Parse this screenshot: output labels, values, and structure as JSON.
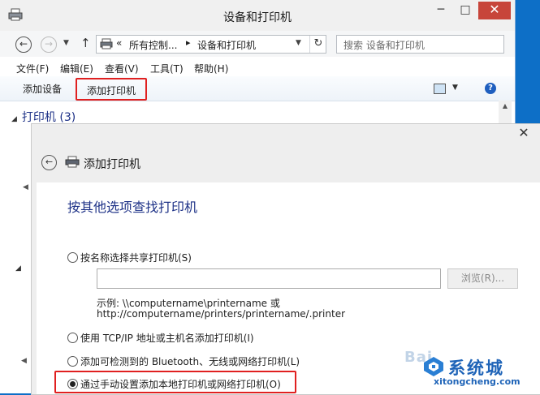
{
  "window": {
    "title": "设备和打印机",
    "controls": {
      "minimize": "─",
      "maximize": "□",
      "close": "✕"
    }
  },
  "address_bar": {
    "overflow": "«",
    "crumbs": [
      "所有控制...",
      "设备和打印机"
    ],
    "separator": "▸",
    "refresh": "↻",
    "back": "←",
    "forward": "→",
    "up": "↑",
    "search_placeholder": "搜索 设备和打印机"
  },
  "menu": {
    "file": "文件(F)",
    "edit": "编辑(E)",
    "view": "查看(V)",
    "tools": "工具(T)",
    "help": "帮助(H)"
  },
  "command_bar": {
    "add_device": "添加设备",
    "add_printer": "添加打印机",
    "help": "?"
  },
  "content": {
    "printers_group": "打印机 (3)"
  },
  "dialog": {
    "close": "✕",
    "back": "←",
    "title": "添加打印机",
    "heading": "按其他选项查找打印机",
    "options": [
      {
        "label": "按名称选择共享打印机(S)",
        "selected": false
      },
      {
        "label": "使用 TCP/IP 地址或主机名添加打印机(I)",
        "selected": false
      },
      {
        "label": "添加可检测到的 Bluetooth、无线或网络打印机(L)",
        "selected": false
      },
      {
        "label": "通过手动设置添加本地打印机或网络打印机(O)",
        "selected": true
      }
    ],
    "share_input_value": "",
    "browse_button": "浏览(R)...",
    "example_line1": "示例: \\\\computername\\printername 或",
    "example_line2": "http://computername/printers/printername/.printer"
  },
  "watermark": {
    "brand": "系统城",
    "url": "xitongcheng.com",
    "faint": "Bai"
  },
  "icons": [
    "app-printer-icon",
    "back-icon",
    "forward-icon",
    "up-icon",
    "refresh-icon",
    "view-options-icon",
    "help-icon",
    "printer-icon",
    "close-icon"
  ],
  "colors": {
    "accent_red": "#e02020",
    "heading_blue": "#1e3287",
    "close_red": "#c7453a",
    "brand_blue": "#1f64b8"
  }
}
